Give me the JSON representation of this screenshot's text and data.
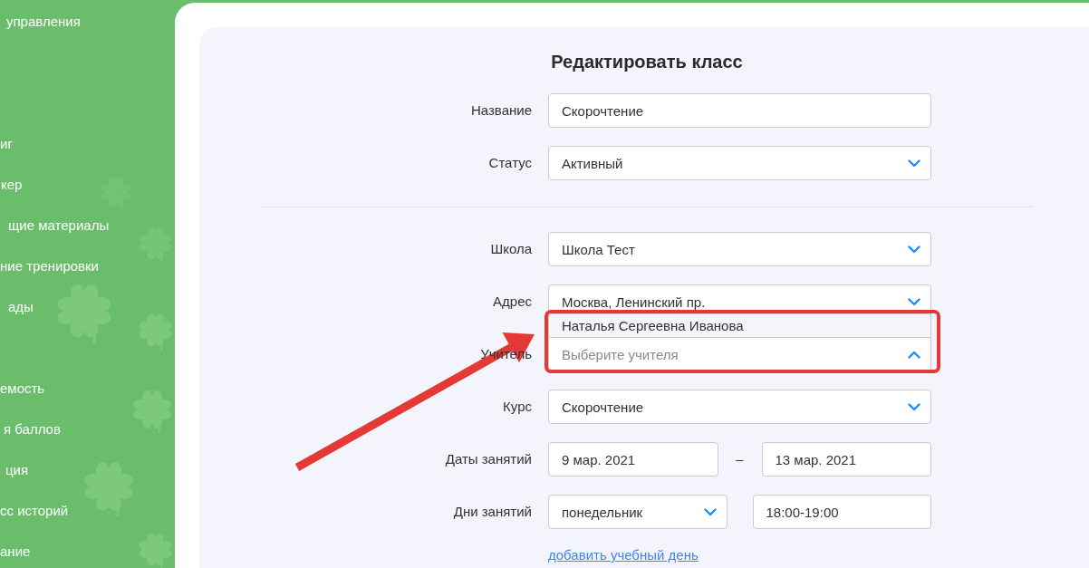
{
  "sidebar": {
    "items": [
      {
        "label": "управления"
      },
      {
        "label": "иг"
      },
      {
        "label": "кер"
      },
      {
        "label": "щие материалы"
      },
      {
        "label": "ние тренировки"
      },
      {
        "label": "ады"
      },
      {
        "label": "емость"
      },
      {
        "label": "я баллов"
      },
      {
        "label": "ция"
      },
      {
        "label": "сс историй"
      },
      {
        "label": "ание"
      }
    ]
  },
  "form": {
    "title": "Редактировать класс",
    "sections": [
      {
        "rows": [
          {
            "label": "Название",
            "controls": [
              {
                "kind": "input",
                "value": "Скорочтение"
              }
            ]
          },
          {
            "label": "Статус",
            "controls": [
              {
                "kind": "select",
                "value": "Активный",
                "expanded": false
              }
            ]
          }
        ]
      },
      {
        "rows": [
          {
            "label": "Школа",
            "controls": [
              {
                "kind": "select",
                "value": "Школа Тест",
                "expanded": false
              }
            ]
          },
          {
            "label": "Адрес",
            "controls": [
              {
                "kind": "select",
                "value": "Москва, Ленинский пр.",
                "expanded": false
              }
            ]
          },
          {
            "label": "Учитель",
            "controls": [
              {
                "kind": "select",
                "placeholder": "Выберите учителя",
                "expanded": true,
                "options": [
                  {
                    "label": "Наталья Сергеевна Иванова",
                    "selected": false
                  }
                ]
              }
            ]
          },
          {
            "label": "Курс",
            "controls": [
              {
                "kind": "select",
                "value": "Скорочтение",
                "expanded": false
              }
            ]
          },
          {
            "label": "Даты занятий",
            "controls": [
              {
                "kind": "input",
                "value": "9 мар. 2021"
              },
              {
                "kind": "separator",
                "text": "–"
              },
              {
                "kind": "input",
                "value": "13 мар. 2021"
              }
            ]
          },
          {
            "label": "Дни занятий",
            "controls": [
              {
                "kind": "select",
                "value": "понедельник",
                "expanded": false
              },
              {
                "kind": "input",
                "value": "18:00-19:00"
              }
            ]
          }
        ]
      }
    ],
    "link": "добавить учебный день"
  }
}
